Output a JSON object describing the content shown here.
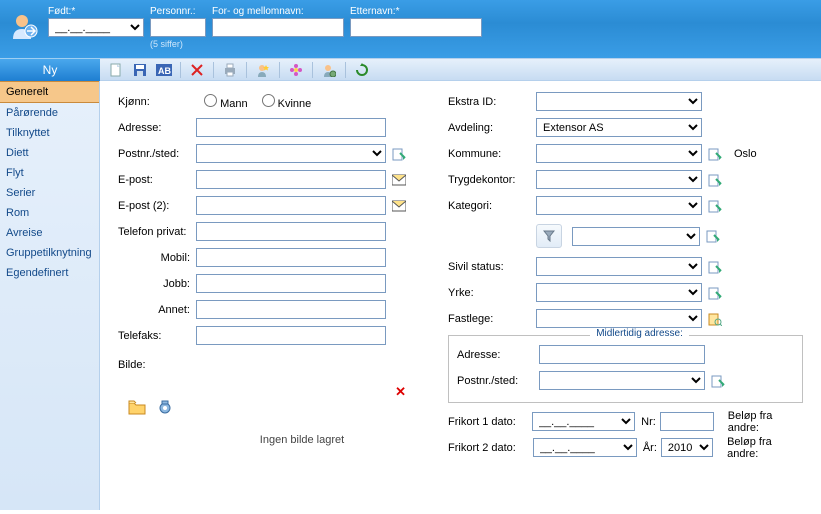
{
  "top": {
    "fodt_label": "Født:*",
    "fodt_value": "__.__.____",
    "personnr_label": "Personnr.:",
    "personnr_value": "",
    "personnr_hint": "(5 siffer)",
    "fornavn_label": "For- og mellomnavn:",
    "fornavn_value": "",
    "etternavn_label": "Etternavn:*",
    "etternavn_value": ""
  },
  "strip": {
    "ny": "Ny"
  },
  "sidebar": {
    "items": [
      "Generelt",
      "Pårørende",
      "Tilknyttet",
      "Diett",
      "Flyt",
      "Serier",
      "Rom",
      "Avreise",
      "Gruppetilknytning",
      "Egendefinert"
    ],
    "active_index": 0
  },
  "left": {
    "kjonn_label": "Kjønn:",
    "mann": "Mann",
    "kvinne": "Kvinne",
    "adresse_label": "Adresse:",
    "adresse_value": "",
    "postnr_label": "Postnr./sted:",
    "postnr_value": "",
    "epost_label": "E-post:",
    "epost_value": "",
    "epost2_label": "E-post (2):",
    "epost2_value": "",
    "telefon_label": "Telefon privat:",
    "telefon_value": "",
    "mobil_label": "Mobil:",
    "mobil_value": "",
    "jobb_label": "Jobb:",
    "jobb_value": "",
    "annet_label": "Annet:",
    "annet_value": "",
    "telefaks_label": "Telefaks:",
    "telefaks_value": "",
    "bilde_label": "Bilde:",
    "bilde_placeholder": "Ingen bilde lagret"
  },
  "right": {
    "ekstraid_label": "Ekstra ID:",
    "ekstraid_value": "",
    "avdeling_label": "Avdeling:",
    "avdeling_value": "Extensor AS",
    "kommune_label": "Kommune:",
    "kommune_value": "",
    "kommune_text": "Oslo",
    "trygdekontor_label": "Trygdekontor:",
    "trygdekontor_value": "",
    "kategori_label": "Kategori:",
    "kategori_value": "",
    "sivil_label": "Sivil status:",
    "sivil_value": "",
    "yrke_label": "Yrke:",
    "yrke_value": "",
    "fastlege_label": "Fastlege:",
    "fastlege_value": "",
    "mid_legend": "Midlertidig adresse:",
    "mid_adresse_label": "Adresse:",
    "mid_adresse_value": "",
    "mid_postnr_label": "Postnr./sted:",
    "mid_postnr_value": "",
    "frikort1_label": "Frikort 1 dato:",
    "frikort1_value": "__.__.____",
    "nr_label": "Nr:",
    "nr_value": "",
    "belop1_label": "Beløp fra andre:",
    "frikort2_label": "Frikort 2 dato:",
    "frikort2_value": "__.__.____",
    "ar_label": "År:",
    "ar_value": "2010",
    "belop2_label": "Beløp fra andre:"
  }
}
